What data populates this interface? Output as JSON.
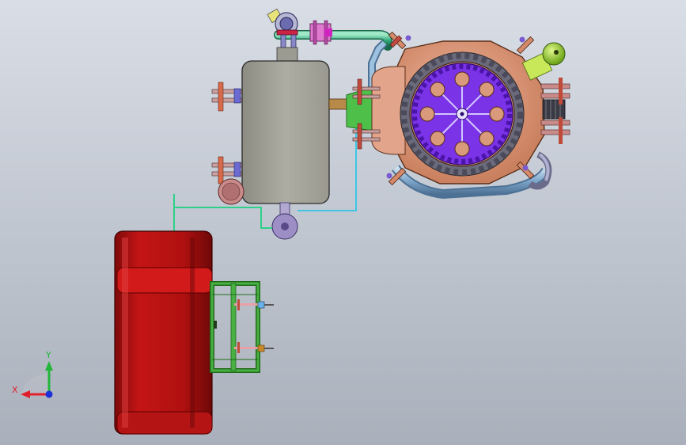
{
  "viewport": {
    "background_top": "#d9dee6",
    "background_bottom": "#a9b0bb"
  },
  "triad": {
    "x_label": "X",
    "y_label": "Y",
    "x_color": "#e0202a",
    "y_color": "#22b53a",
    "z_color": "#1d2fd6"
  },
  "model": {
    "icons": {
      "tank": "pressure-tank-icon",
      "engine": "radial-engine-icon",
      "fan": "blower-housing-icon",
      "bracket": "mounting-bracket-icon"
    },
    "colors": {
      "tank": "#a09f95",
      "engine_body": "#d9987a",
      "gear": "#8a2be2",
      "fan_body": "#c01010",
      "bracket": "#2f9a2a",
      "pipe_cyan": "#2fc0c0",
      "pipe_green": "#3aa86a",
      "pipe_blue": "#8fb6d8",
      "mount_purple": "#8e7ab8",
      "accent_green": "#9bd02a"
    }
  }
}
